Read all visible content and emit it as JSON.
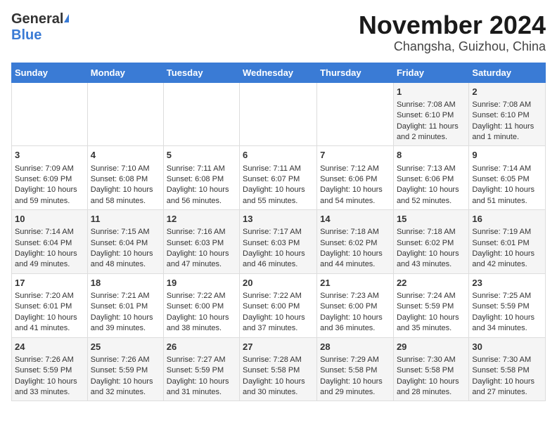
{
  "header": {
    "logo_general": "General",
    "logo_blue": "Blue",
    "title": "November 2024",
    "subtitle": "Changsha, Guizhou, China"
  },
  "days_of_week": [
    "Sunday",
    "Monday",
    "Tuesday",
    "Wednesday",
    "Thursday",
    "Friday",
    "Saturday"
  ],
  "weeks": [
    [
      {
        "day": "",
        "sunrise": "",
        "sunset": "",
        "daylight": ""
      },
      {
        "day": "",
        "sunrise": "",
        "sunset": "",
        "daylight": ""
      },
      {
        "day": "",
        "sunrise": "",
        "sunset": "",
        "daylight": ""
      },
      {
        "day": "",
        "sunrise": "",
        "sunset": "",
        "daylight": ""
      },
      {
        "day": "",
        "sunrise": "",
        "sunset": "",
        "daylight": ""
      },
      {
        "day": "1",
        "sunrise": "Sunrise: 7:08 AM",
        "sunset": "Sunset: 6:10 PM",
        "daylight": "Daylight: 11 hours and 2 minutes."
      },
      {
        "day": "2",
        "sunrise": "Sunrise: 7:08 AM",
        "sunset": "Sunset: 6:10 PM",
        "daylight": "Daylight: 11 hours and 1 minute."
      }
    ],
    [
      {
        "day": "3",
        "sunrise": "Sunrise: 7:09 AM",
        "sunset": "Sunset: 6:09 PM",
        "daylight": "Daylight: 10 hours and 59 minutes."
      },
      {
        "day": "4",
        "sunrise": "Sunrise: 7:10 AM",
        "sunset": "Sunset: 6:08 PM",
        "daylight": "Daylight: 10 hours and 58 minutes."
      },
      {
        "day": "5",
        "sunrise": "Sunrise: 7:11 AM",
        "sunset": "Sunset: 6:08 PM",
        "daylight": "Daylight: 10 hours and 56 minutes."
      },
      {
        "day": "6",
        "sunrise": "Sunrise: 7:11 AM",
        "sunset": "Sunset: 6:07 PM",
        "daylight": "Daylight: 10 hours and 55 minutes."
      },
      {
        "day": "7",
        "sunrise": "Sunrise: 7:12 AM",
        "sunset": "Sunset: 6:06 PM",
        "daylight": "Daylight: 10 hours and 54 minutes."
      },
      {
        "day": "8",
        "sunrise": "Sunrise: 7:13 AM",
        "sunset": "Sunset: 6:06 PM",
        "daylight": "Daylight: 10 hours and 52 minutes."
      },
      {
        "day": "9",
        "sunrise": "Sunrise: 7:14 AM",
        "sunset": "Sunset: 6:05 PM",
        "daylight": "Daylight: 10 hours and 51 minutes."
      }
    ],
    [
      {
        "day": "10",
        "sunrise": "Sunrise: 7:14 AM",
        "sunset": "Sunset: 6:04 PM",
        "daylight": "Daylight: 10 hours and 49 minutes."
      },
      {
        "day": "11",
        "sunrise": "Sunrise: 7:15 AM",
        "sunset": "Sunset: 6:04 PM",
        "daylight": "Daylight: 10 hours and 48 minutes."
      },
      {
        "day": "12",
        "sunrise": "Sunrise: 7:16 AM",
        "sunset": "Sunset: 6:03 PM",
        "daylight": "Daylight: 10 hours and 47 minutes."
      },
      {
        "day": "13",
        "sunrise": "Sunrise: 7:17 AM",
        "sunset": "Sunset: 6:03 PM",
        "daylight": "Daylight: 10 hours and 46 minutes."
      },
      {
        "day": "14",
        "sunrise": "Sunrise: 7:18 AM",
        "sunset": "Sunset: 6:02 PM",
        "daylight": "Daylight: 10 hours and 44 minutes."
      },
      {
        "day": "15",
        "sunrise": "Sunrise: 7:18 AM",
        "sunset": "Sunset: 6:02 PM",
        "daylight": "Daylight: 10 hours and 43 minutes."
      },
      {
        "day": "16",
        "sunrise": "Sunrise: 7:19 AM",
        "sunset": "Sunset: 6:01 PM",
        "daylight": "Daylight: 10 hours and 42 minutes."
      }
    ],
    [
      {
        "day": "17",
        "sunrise": "Sunrise: 7:20 AM",
        "sunset": "Sunset: 6:01 PM",
        "daylight": "Daylight: 10 hours and 41 minutes."
      },
      {
        "day": "18",
        "sunrise": "Sunrise: 7:21 AM",
        "sunset": "Sunset: 6:01 PM",
        "daylight": "Daylight: 10 hours and 39 minutes."
      },
      {
        "day": "19",
        "sunrise": "Sunrise: 7:22 AM",
        "sunset": "Sunset: 6:00 PM",
        "daylight": "Daylight: 10 hours and 38 minutes."
      },
      {
        "day": "20",
        "sunrise": "Sunrise: 7:22 AM",
        "sunset": "Sunset: 6:00 PM",
        "daylight": "Daylight: 10 hours and 37 minutes."
      },
      {
        "day": "21",
        "sunrise": "Sunrise: 7:23 AM",
        "sunset": "Sunset: 6:00 PM",
        "daylight": "Daylight: 10 hours and 36 minutes."
      },
      {
        "day": "22",
        "sunrise": "Sunrise: 7:24 AM",
        "sunset": "Sunset: 5:59 PM",
        "daylight": "Daylight: 10 hours and 35 minutes."
      },
      {
        "day": "23",
        "sunrise": "Sunrise: 7:25 AM",
        "sunset": "Sunset: 5:59 PM",
        "daylight": "Daylight: 10 hours and 34 minutes."
      }
    ],
    [
      {
        "day": "24",
        "sunrise": "Sunrise: 7:26 AM",
        "sunset": "Sunset: 5:59 PM",
        "daylight": "Daylight: 10 hours and 33 minutes."
      },
      {
        "day": "25",
        "sunrise": "Sunrise: 7:26 AM",
        "sunset": "Sunset: 5:59 PM",
        "daylight": "Daylight: 10 hours and 32 minutes."
      },
      {
        "day": "26",
        "sunrise": "Sunrise: 7:27 AM",
        "sunset": "Sunset: 5:59 PM",
        "daylight": "Daylight: 10 hours and 31 minutes."
      },
      {
        "day": "27",
        "sunrise": "Sunrise: 7:28 AM",
        "sunset": "Sunset: 5:58 PM",
        "daylight": "Daylight: 10 hours and 30 minutes."
      },
      {
        "day": "28",
        "sunrise": "Sunrise: 7:29 AM",
        "sunset": "Sunset: 5:58 PM",
        "daylight": "Daylight: 10 hours and 29 minutes."
      },
      {
        "day": "29",
        "sunrise": "Sunrise: 7:30 AM",
        "sunset": "Sunset: 5:58 PM",
        "daylight": "Daylight: 10 hours and 28 minutes."
      },
      {
        "day": "30",
        "sunrise": "Sunrise: 7:30 AM",
        "sunset": "Sunset: 5:58 PM",
        "daylight": "Daylight: 10 hours and 27 minutes."
      }
    ]
  ]
}
